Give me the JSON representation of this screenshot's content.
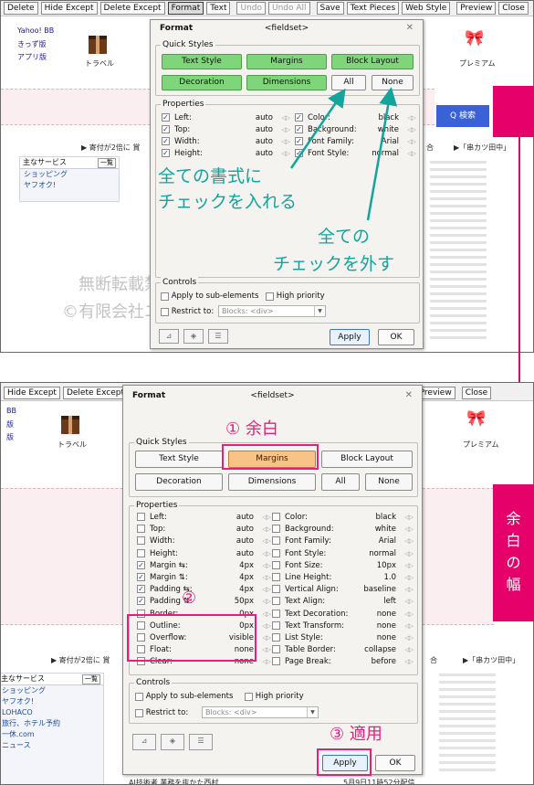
{
  "top_panel": {
    "toolbar": [
      {
        "label": "Delete",
        "state": "normal"
      },
      {
        "label": "Hide Except",
        "state": "normal"
      },
      {
        "label": "Delete Except",
        "state": "normal"
      },
      {
        "label": "Format",
        "state": "selected"
      },
      {
        "label": "Text",
        "state": "normal"
      },
      {
        "label": "Undo",
        "state": "disabled"
      },
      {
        "label": "Undo All",
        "state": "disabled"
      },
      {
        "label": "Save",
        "state": "normal"
      },
      {
        "label": "Text Pieces",
        "state": "normal"
      },
      {
        "label": "Web Style",
        "state": "normal"
      },
      {
        "label": "Preview",
        "state": "normal"
      },
      {
        "label": "Close",
        "state": "normal"
      }
    ],
    "site": {
      "yahoo_lines": [
        "Yahoo! BB",
        "きっず版",
        "アプリ版"
      ],
      "travel": "トラベル",
      "premium": "プレミアム",
      "search_btn": "Q 検索",
      "kifu": "▶ 寄付が2倍に 賞",
      "sidebar_header": "主なサービス",
      "sidebar_ichiran": "一覧",
      "sidebar_items": [
        "ショッピング",
        "ヤフオク!"
      ]
    },
    "dialog": {
      "title": "Format",
      "fieldset": "<fieldset>",
      "quick_styles_label": "Quick Styles",
      "quick": [
        "Text Style",
        "Margins",
        "Block Layout",
        "Decoration",
        "Dimensions",
        "All",
        "None"
      ],
      "properties_label": "Properties",
      "props_left": [
        {
          "name": "Left:",
          "value": "auto",
          "checked": true
        },
        {
          "name": "Top:",
          "value": "auto",
          "checked": true
        },
        {
          "name": "Width:",
          "value": "auto",
          "checked": true
        },
        {
          "name": "Height:",
          "value": "auto",
          "checked": true
        }
      ],
      "props_right": [
        {
          "name": "Color:",
          "value": "black",
          "checked": true
        },
        {
          "name": "Background:",
          "value": "white",
          "checked": true
        },
        {
          "name": "Font Family:",
          "value": "Arial",
          "checked": true
        },
        {
          "name": "Font Style:",
          "value": "normal",
          "checked": true
        }
      ],
      "controls_label": "Controls",
      "apply_sub": "Apply to sub-elements",
      "high_priority": "High priority",
      "restrict_to": "Restrict to:",
      "restrict_value": "Blocks: <div>",
      "apply": "Apply",
      "ok": "OK"
    },
    "annotations": {
      "check_all_line1": "全ての書式に",
      "check_all_line2": "チェックを入れる",
      "uncheck_line1": "全ての",
      "uncheck_line2": "チェックを外す"
    },
    "watermark": [
      "無断転載禁止",
      "©有限会社エ"
    ]
  },
  "bottom_panel": {
    "toolbar": [
      {
        "label": "Hide Except",
        "state": "normal"
      },
      {
        "label": "Delete Except",
        "state": "normal"
      },
      {
        "label": "Format",
        "state": "selected"
      },
      {
        "label": "Text",
        "state": "normal"
      },
      {
        "label": "Undo",
        "state": "normal"
      },
      {
        "label": "Undo All",
        "state": "normal"
      },
      {
        "label": "Save",
        "state": "normal"
      },
      {
        "label": "Text Pieces",
        "state": "normal"
      },
      {
        "label": "Web Style",
        "state": "normal"
      },
      {
        "label": "Preview",
        "state": "normal"
      },
      {
        "label": "Close",
        "state": "normal"
      }
    ],
    "site": {
      "bb_lines": [
        "BB",
        "版",
        "版"
      ],
      "travel": "トラベル",
      "premium": "プレミアム",
      "kifu": "▶ 寄付が2倍に 賞",
      "right_a": "合",
      "right_b": "▶「串カツ田中」",
      "sidebar_header": "主なサービス",
      "sidebar_ichiran": "一覧",
      "sidebar_items": [
        "ショッピング",
        "ヤフオク!",
        "LOHACO",
        "旅行、ホテル予約",
        "一休.com",
        "ニュース"
      ],
      "bottom_text": "AI技術者 業務を抜かた西村",
      "bottom_date": "5月9日11時52分配信"
    },
    "dialog": {
      "title": "Format",
      "fieldset": "<fieldset>",
      "quick_styles_label": "Quick Styles",
      "quick": [
        "Text Style",
        "Margins",
        "Block Layout",
        "Decoration",
        "Dimensions",
        "All",
        "None"
      ],
      "properties_label": "Properties",
      "props_left": [
        {
          "name": "Left:",
          "value": "auto",
          "checked": false
        },
        {
          "name": "Top:",
          "value": "auto",
          "checked": false
        },
        {
          "name": "Width:",
          "value": "auto",
          "checked": false
        },
        {
          "name": "Height:",
          "value": "auto",
          "checked": false
        },
        {
          "name": "Margin ⇆:",
          "value": "4px",
          "checked": true
        },
        {
          "name": "Margin ⇅:",
          "value": "4px",
          "checked": true
        },
        {
          "name": "Padding ⇆:",
          "value": "4px",
          "checked": true
        },
        {
          "name": "Padding ⇅:",
          "value": "50px",
          "checked": true
        },
        {
          "name": "Border:",
          "value": "0px",
          "checked": false
        },
        {
          "name": "Outline:",
          "value": "0px",
          "checked": false
        },
        {
          "name": "Overflow:",
          "value": "visible",
          "checked": false
        },
        {
          "name": "Float:",
          "value": "none",
          "checked": false
        },
        {
          "name": "Clear:",
          "value": "none",
          "checked": false
        }
      ],
      "props_right": [
        {
          "name": "Color:",
          "value": "black",
          "checked": false
        },
        {
          "name": "Background:",
          "value": "white",
          "checked": false
        },
        {
          "name": "Font Family:",
          "value": "Arial",
          "checked": false
        },
        {
          "name": "Font Style:",
          "value": "normal",
          "checked": false
        },
        {
          "name": "Font Size:",
          "value": "10px",
          "checked": false
        },
        {
          "name": "Line Height:",
          "value": "1.0",
          "checked": false
        },
        {
          "name": "Vertical Align:",
          "value": "baseline",
          "checked": false
        },
        {
          "name": "Text Align:",
          "value": "left",
          "checked": false
        },
        {
          "name": "Text Decoration:",
          "value": "none",
          "checked": false
        },
        {
          "name": "Text Transform:",
          "value": "none",
          "checked": false
        },
        {
          "name": "List Style:",
          "value": "none",
          "checked": false
        },
        {
          "name": "Table Border:",
          "value": "collapse",
          "checked": false
        },
        {
          "name": "Page Break:",
          "value": "before",
          "checked": false
        }
      ],
      "controls_label": "Controls",
      "apply_sub": "Apply to sub-elements",
      "high_priority": "High priority",
      "restrict_to": "Restrict to:",
      "restrict_value": "Blocks: <div>",
      "apply": "Apply",
      "ok": "OK"
    },
    "annotations": {
      "step1": "① 余白",
      "step2": "②",
      "step3": "③ 適用"
    }
  },
  "margin_label": [
    "余",
    "白",
    "の",
    "幅"
  ],
  "colors": {
    "annotation_teal": "#13a49b",
    "highlight_pink": "#e5207b",
    "magenta": "#e5006a",
    "green_button": "#7fd67a",
    "orange_button": "#f7c386"
  }
}
